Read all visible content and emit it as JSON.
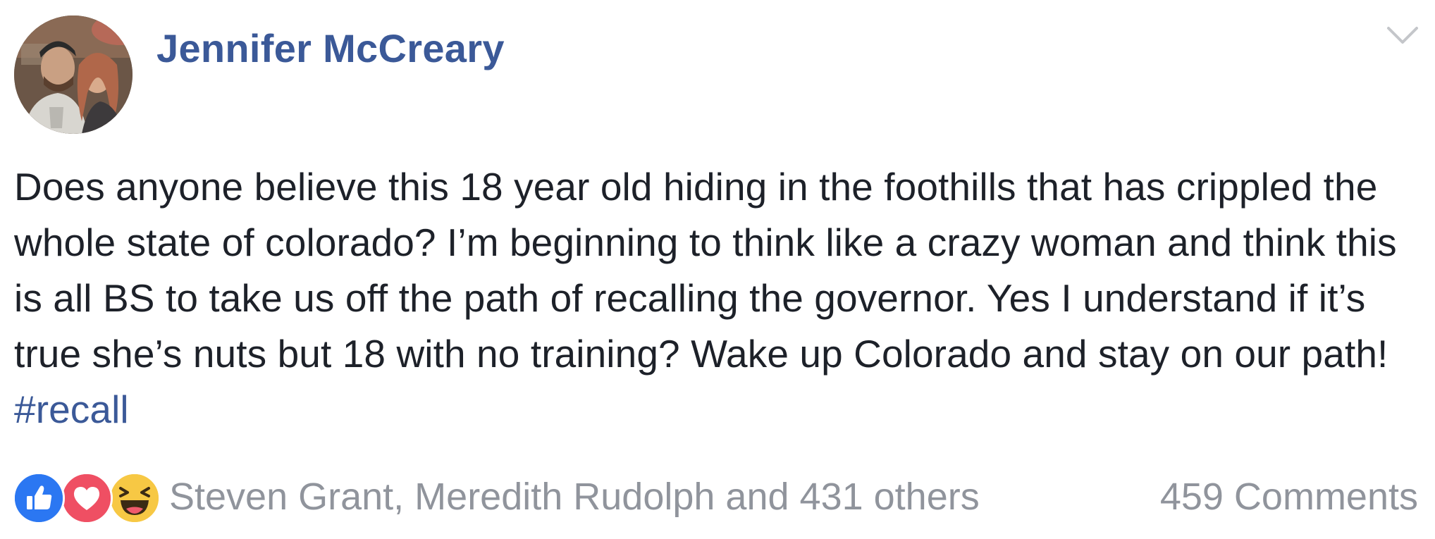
{
  "post": {
    "author_name": "Jennifer McCreary",
    "text": "Does anyone believe this 18 year old hiding in the foothills that has crippled the whole state of colorado? I’m beginning to think like a crazy woman and think this is all BS to take us off the path of recalling the governor. Yes I understand if it’s true she’s nuts but 18 with no training? Wake up Colorado and stay on our path! ",
    "hashtag": "#recall"
  },
  "footer": {
    "reaction_names": "Steven Grant, Meredith Rudolph and 431 others",
    "comments": "459 Comments"
  },
  "icons": {
    "menu": "chevron-down-icon",
    "reactions": [
      "like-reaction-icon",
      "love-reaction-icon",
      "haha-reaction-icon"
    ]
  },
  "colors": {
    "author": "#3b5998",
    "hashtag": "#3b5998",
    "body_text": "#1d2129",
    "meta_text": "#90949c",
    "like": "#2b77f2",
    "love": "#ef4f63",
    "haha": "#f7c844"
  }
}
